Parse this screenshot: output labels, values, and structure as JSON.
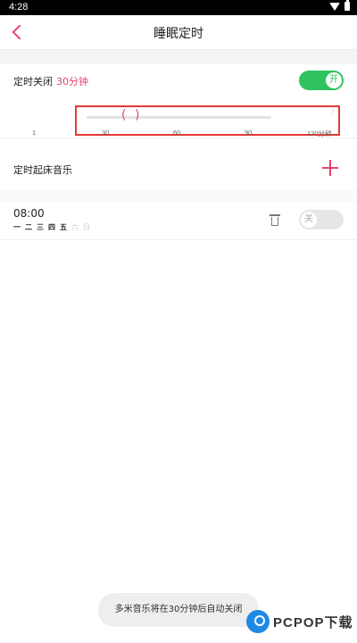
{
  "status": {
    "time": "4:28"
  },
  "header": {
    "title": "睡眠定时"
  },
  "timer": {
    "label": "定时关闭",
    "value": "30分钟",
    "toggle_label": "开"
  },
  "slider": {
    "ticks": [
      "1",
      "30",
      "60",
      "90",
      "120分钟"
    ],
    "value": 30
  },
  "alarm": {
    "title": "定时起床音乐"
  },
  "alarm_item": {
    "time": "08:00",
    "days": [
      {
        "label": "一",
        "active": true
      },
      {
        "label": "二",
        "active": true
      },
      {
        "label": "三",
        "active": true
      },
      {
        "label": "四",
        "active": true
      },
      {
        "label": "五",
        "active": true
      },
      {
        "label": "六",
        "active": false
      },
      {
        "label": "日",
        "active": false
      }
    ],
    "toggle_label": "关"
  },
  "toast": {
    "text": "多米音乐将在30分钟后自动关闭"
  },
  "watermark": {
    "text": "PCPOP下载"
  },
  "colors": {
    "accent": "#e8436e",
    "toggle_on": "#2ec35f"
  }
}
